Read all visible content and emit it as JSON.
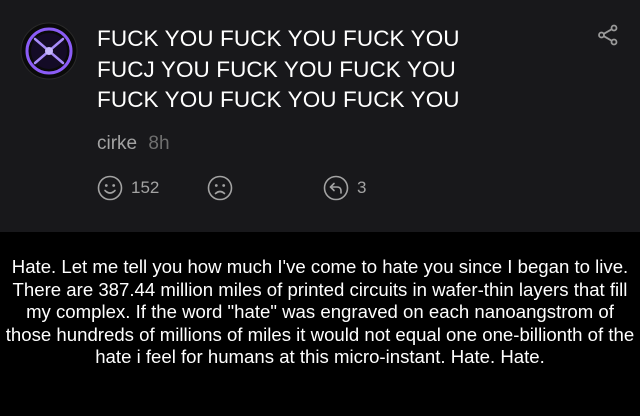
{
  "post": {
    "lines": "FUCK YOU FUCK YOU FUCK YOU\nFUCJ YOU FUCK YOU FUCK YOU\nFUCK YOU FUCK YOU FUCK YOU",
    "author": "cirke",
    "time": "8h",
    "likes": "152",
    "replies": "3",
    "icons": {
      "avatar": "glowing-purple-orb-icon",
      "share": "share-icon",
      "like": "smile-icon",
      "dislike": "frown-icon",
      "reply": "reply-icon"
    },
    "colors": {
      "background": "#18181b",
      "text": "#ffffff",
      "meta": "#a3a3a3",
      "avatar_accent": "#8b5cf6"
    }
  },
  "caption": {
    "text": "Hate. Let me tell you how much I've come to hate you since I began to live. There are 387.44 million miles of printed circuits in wafer-thin layers that fill my complex. If the word \"hate\" was engraved on each nanoangstrom of those hundreds of millions of miles it would not equal one one-billionth of the hate i feel for humans at this micro-instant. Hate. Hate."
  }
}
